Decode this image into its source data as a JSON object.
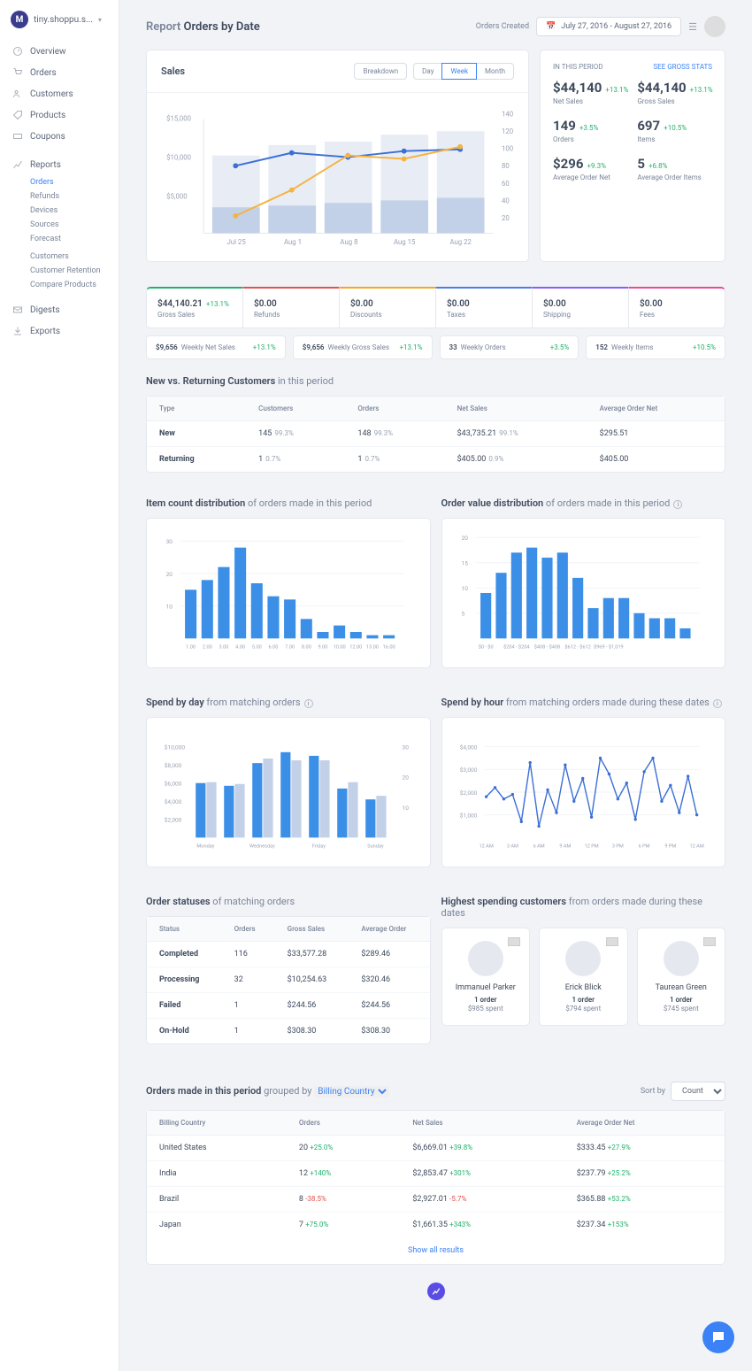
{
  "brand": {
    "initial": "M",
    "name": "tiny.shoppu.s..."
  },
  "nav": {
    "overview": "Overview",
    "orders": "Orders",
    "customers": "Customers",
    "products": "Products",
    "coupons": "Coupons",
    "reports": "Reports",
    "digests": "Digests",
    "exports": "Exports",
    "reportSub": {
      "orders": "Orders",
      "refunds": "Refunds",
      "devices": "Devices",
      "sources": "Sources",
      "forecast": "Forecast",
      "customers": "Customers",
      "retention": "Customer Retention",
      "compare": "Compare Products"
    }
  },
  "header": {
    "title_a": "Report",
    "title_b": " Orders by Date",
    "orders_created": "Orders Created",
    "date_range": "July 27, 2016 - August 27, 2016"
  },
  "sales": {
    "title": "Sales",
    "breakdown": "Breakdown",
    "day": "Day",
    "week": "Week",
    "month": "Month"
  },
  "kpi": {
    "period": "IN THIS PERIOD",
    "gross_link": "SEE GROSS STATS",
    "net_sales": {
      "val": "$44,140",
      "chg": "+13.1%",
      "lbl": "Net Sales"
    },
    "gross_sales": {
      "val": "$44,140",
      "chg": "+13.1%",
      "lbl": "Gross Sales"
    },
    "orders": {
      "val": "149",
      "chg": "+3.5%",
      "lbl": "Orders"
    },
    "items": {
      "val": "697",
      "chg": "+10.5%",
      "lbl": "Items"
    },
    "avg_net": {
      "val": "$296",
      "chg": "+9.3%",
      "lbl": "Average Order Net"
    },
    "avg_items": {
      "val": "5",
      "chg": "+6.8%",
      "lbl": "Average Order Items"
    }
  },
  "tiles": [
    {
      "val": "$44,140.21",
      "chg": "+13.1%",
      "lbl": "Gross Sales",
      "color": "#20b26c"
    },
    {
      "val": "$0.00",
      "chg": "",
      "lbl": "Refunds",
      "color": "#e0524e"
    },
    {
      "val": "$0.00",
      "chg": "",
      "lbl": "Discounts",
      "color": "#f5a623"
    },
    {
      "val": "$0.00",
      "chg": "",
      "lbl": "Taxes",
      "color": "#4a7de6"
    },
    {
      "val": "$0.00",
      "chg": "",
      "lbl": "Shipping",
      "color": "#8b5cf6"
    },
    {
      "val": "$0.00",
      "chg": "",
      "lbl": "Fees",
      "color": "#ec4899"
    }
  ],
  "weekly": [
    {
      "val": "$9,656",
      "lbl": "Weekly Net Sales",
      "chg": "+13.1%"
    },
    {
      "val": "$9,656",
      "lbl": "Weekly Gross Sales",
      "chg": "+13.1%"
    },
    {
      "val": "33",
      "lbl": "Weekly Orders",
      "chg": "+3.5%"
    },
    {
      "val": "152",
      "lbl": "Weekly Items",
      "chg": "+10.5%"
    }
  ],
  "nvr": {
    "title_b": "New vs. Returning Customers",
    "title_s": " in this period",
    "headers": [
      "Type",
      "Customers",
      "Orders",
      "Net Sales",
      "Average Order Net"
    ],
    "rows": [
      {
        "type": "New",
        "cust": "145",
        "cust_pct": "99.3%",
        "orders": "148",
        "orders_pct": "99.3%",
        "net": "$43,735.21",
        "net_pct": "99.1%",
        "aon": "$295.51"
      },
      {
        "type": "Returning",
        "cust": "1",
        "cust_pct": "0.7%",
        "orders": "1",
        "orders_pct": "0.7%",
        "net": "$405.00",
        "net_pct": "0.9%",
        "aon": "$405.00"
      }
    ]
  },
  "dist": {
    "item_title_b": "Item count distribution",
    "item_title_s": " of orders made in this period",
    "value_title_b": "Order value distribution",
    "value_title_s": " of orders made in this period"
  },
  "spend": {
    "day_title_b": "Spend by day",
    "day_title_s": " from matching orders",
    "hour_title_b": "Spend by hour",
    "hour_title_s": " from matching orders made during these dates"
  },
  "statuses": {
    "title_b": "Order statuses",
    "title_s": " of matching orders",
    "headers": [
      "Status",
      "Orders",
      "Gross Sales",
      "Average Order"
    ],
    "rows": [
      {
        "s": "Completed",
        "o": "116",
        "g": "$33,577.28",
        "a": "$289.46"
      },
      {
        "s": "Processing",
        "o": "32",
        "g": "$10,254.63",
        "a": "$320.46"
      },
      {
        "s": "Failed",
        "o": "1",
        "g": "$244.56",
        "a": "$244.56"
      },
      {
        "s": "On-Hold",
        "o": "1",
        "g": "$308.30",
        "a": "$308.30"
      }
    ]
  },
  "topcust": {
    "title_b": "Highest spending customers",
    "title_s": " from orders made during these dates",
    "list": [
      {
        "name": "Immanuel Parker",
        "orders": "1 order",
        "spent": "$985 spent"
      },
      {
        "name": "Erick Blick",
        "orders": "1 order",
        "spent": "$794 spent"
      },
      {
        "name": "Taurean Green",
        "orders": "1 order",
        "spent": "$745 spent"
      }
    ]
  },
  "grouped": {
    "title_b": "Orders made in this period",
    "grouped_by": " grouped by",
    "select": "Billing Country",
    "sort_label": "Sort by",
    "sort_value": "Count",
    "headers": [
      "Billing Country",
      "Orders",
      "Net Sales",
      "Average Order Net"
    ],
    "rows": [
      {
        "c": "United States",
        "o": "20",
        "och": "+25.0%",
        "ocls": "pos",
        "n": "$6,669.01",
        "nch": "+39.8%",
        "ncls": "pos",
        "a": "$333.45",
        "ach": "+27.9%",
        "acls": "pos"
      },
      {
        "c": "India",
        "o": "12",
        "och": "+140%",
        "ocls": "pos",
        "n": "$2,853.47",
        "nch": "+301%",
        "ncls": "pos",
        "a": "$237.79",
        "ach": "+25.2%",
        "acls": "pos"
      },
      {
        "c": "Brazil",
        "o": "8",
        "och": "-38.5%",
        "ocls": "neg",
        "n": "$2,927.01",
        "nch": "-5.7%",
        "ncls": "neg",
        "a": "$365.88",
        "ach": "+53.2%",
        "acls": "pos"
      },
      {
        "c": "Japan",
        "o": "7",
        "och": "+75.0%",
        "ocls": "pos",
        "n": "$1,661.35",
        "nch": "+343%",
        "ncls": "pos",
        "a": "$237.34",
        "ach": "+153%",
        "acls": "pos"
      }
    ],
    "show_all": "Show all results"
  },
  "chart_data": {
    "sales": {
      "type": "combo",
      "x": [
        "Jul 25",
        "Aug 1",
        "Aug 8",
        "Aug 15",
        "Aug 22"
      ],
      "bars": [
        9400,
        10800,
        11200,
        12100,
        12600
      ],
      "line_blue": [
        79,
        92,
        88,
        94,
        96
      ],
      "line_orange": [
        23,
        48,
        90,
        86,
        102
      ],
      "yleft": [
        0,
        5000,
        10000,
        15000
      ],
      "yright": [
        20,
        40,
        60,
        80,
        100,
        120,
        140
      ]
    },
    "item_dist": {
      "type": "bar",
      "x": [
        "1.00",
        "2.00",
        "3.00",
        "4.00",
        "5.00",
        "6.00",
        "7.00",
        "8.00",
        "9.00",
        "10.00",
        "12.00",
        "13.00",
        "16.00"
      ],
      "values": [
        15,
        18,
        22,
        28,
        17,
        13,
        12,
        6,
        2,
        4,
        2,
        1,
        1
      ],
      "yticks": [
        10,
        20,
        30
      ]
    },
    "value_dist": {
      "type": "bar",
      "x": [
        "$0 - $0",
        "",
        "$204 - $204",
        "",
        "$408 - $408",
        "",
        "$612 - $612",
        "",
        "$969 - $1,019"
      ],
      "values": [
        9,
        13,
        17,
        18,
        16,
        17,
        12,
        6,
        8,
        8,
        5,
        4,
        4,
        2
      ],
      "yticks": [
        5,
        10,
        15,
        20
      ]
    },
    "spend_day": {
      "type": "grouped-bar",
      "x": [
        "Monday",
        "",
        "Wednesday",
        "",
        "Friday",
        "",
        "Sunday"
      ],
      "series": [
        {
          "name": "current",
          "values": [
            6000,
            5700,
            8200,
            9400,
            9000,
            5400,
            4200
          ]
        },
        {
          "name": "prev",
          "values": [
            6100,
            5900,
            8700,
            8500,
            8500,
            6100,
            4600
          ]
        }
      ],
      "yleft": [
        2000,
        4000,
        6000,
        8000,
        10000
      ],
      "yright": [
        10,
        20,
        30
      ]
    },
    "spend_hour": {
      "type": "line",
      "x": [
        "12 AM",
        "3 AM",
        "6 AM",
        "9 AM",
        "12 PM",
        "3 PM",
        "6 PM",
        "9 PM",
        "12 AM"
      ],
      "values": [
        1800,
        2200,
        1700,
        1900,
        700,
        3300,
        500,
        2100,
        1100,
        3200,
        1600,
        2600,
        900,
        3500,
        2800,
        1700,
        2400,
        800,
        2900,
        3500,
        1600,
        2300,
        1100,
        2700,
        1000
      ],
      "yticks": [
        1000,
        2000,
        3000,
        4000
      ]
    }
  }
}
